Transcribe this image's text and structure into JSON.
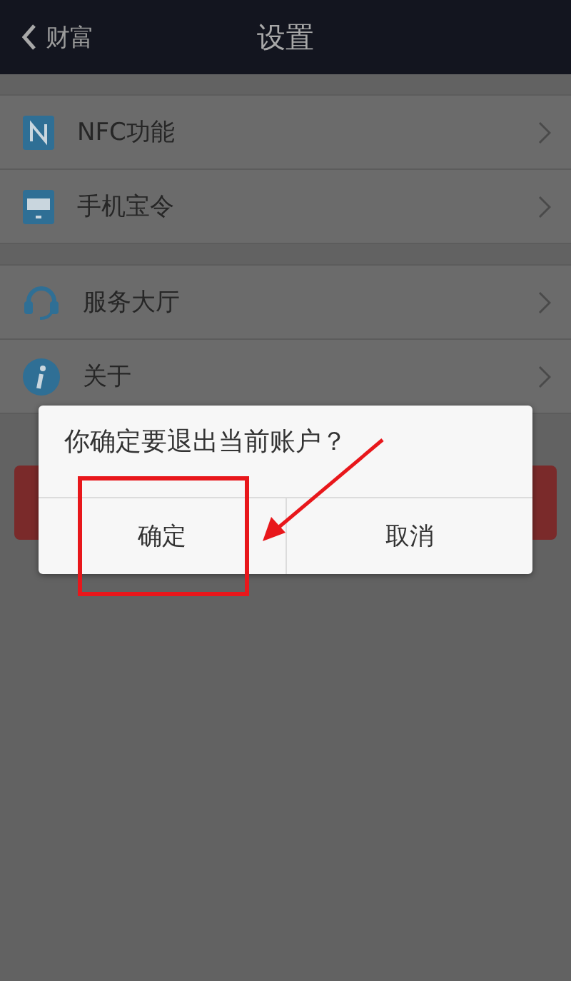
{
  "header": {
    "back_label": "财富",
    "title": "设置"
  },
  "groups": [
    {
      "items": [
        {
          "label": "NFC功能",
          "kind": "nfc"
        },
        {
          "label": "手机宝令",
          "kind": "token"
        }
      ]
    },
    {
      "items": [
        {
          "label": "服务大厅",
          "kind": "headset"
        },
        {
          "label": "关于",
          "kind": "info"
        }
      ]
    }
  ],
  "dialog": {
    "message": "你确定要退出当前账户？",
    "buttons": [
      {
        "label": "确定"
      },
      {
        "label": "取消"
      }
    ]
  }
}
